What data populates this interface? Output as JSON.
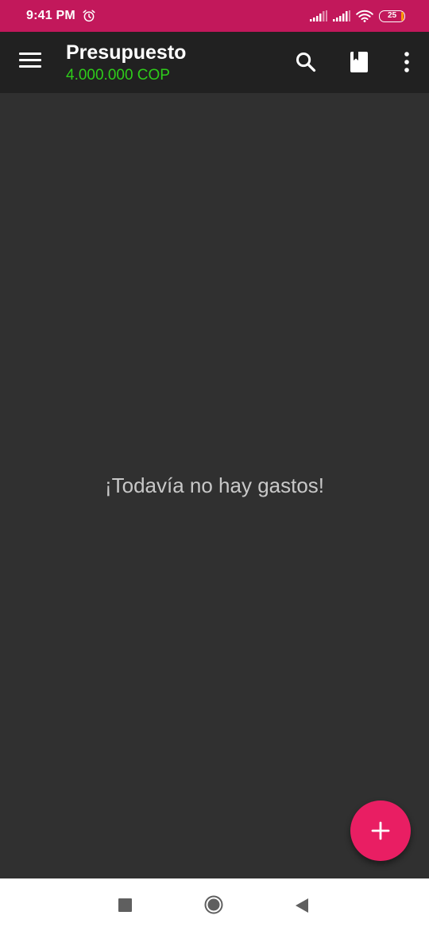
{
  "status_bar": {
    "time": "9:41 PM",
    "battery": "25",
    "icons": [
      "alarm-icon",
      "signal-icon",
      "signal-icon",
      "wifi-icon",
      "battery-icon"
    ],
    "background": "#c2185b"
  },
  "app_bar": {
    "title": "Presupuesto",
    "budget": "4.000.000 COP",
    "budget_color": "#2ecc1a",
    "icons": [
      "menu-icon",
      "search-icon",
      "book-icon",
      "more-vert-icon"
    ]
  },
  "main": {
    "empty_message": "¡Todavía no hay gastos!"
  },
  "fab": {
    "icon": "plus-icon",
    "color": "#e91e63"
  },
  "nav_bar": {
    "icons": [
      "recent-apps-icon",
      "home-icon",
      "back-icon"
    ]
  }
}
